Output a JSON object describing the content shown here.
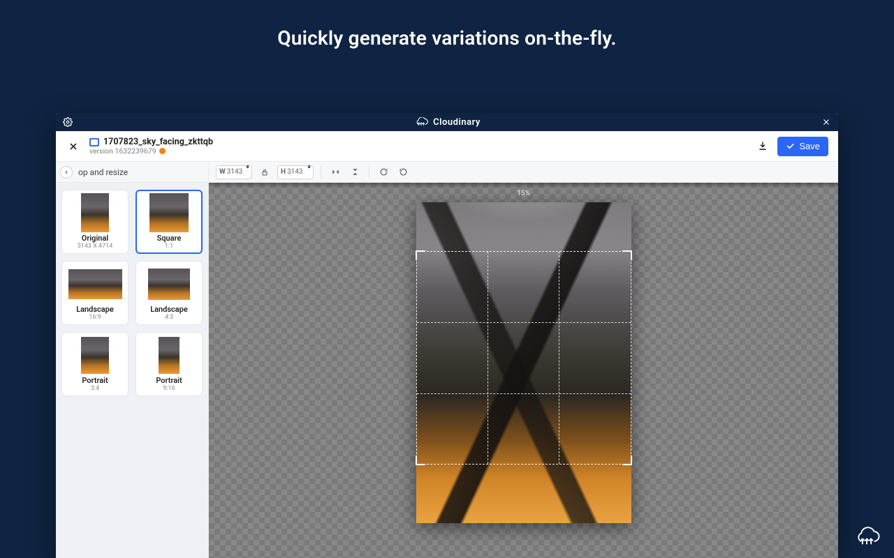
{
  "headline": "Quickly generate variations on-the-fly.",
  "brand": "Cloudinary",
  "file": {
    "name": "1707823_sky_facing_zkttqb",
    "version_label": "version 1632239679"
  },
  "actions": {
    "save": "Save"
  },
  "panel": {
    "title": "op and resize"
  },
  "dims": {
    "w_label": "W",
    "w_value": "3143",
    "h_label": "H",
    "h_value": "3143"
  },
  "zoom": "15%",
  "presets": [
    {
      "name": "Original",
      "sub": "3143 X 4714",
      "thumb": "thumb-orig",
      "selected": false
    },
    {
      "name": "Square",
      "sub": "1:1",
      "thumb": "thumb-sq",
      "selected": true
    },
    {
      "name": "Landscape",
      "sub": "16:9",
      "thumb": "thumb-169",
      "selected": false
    },
    {
      "name": "Landscape",
      "sub": "4:3",
      "thumb": "thumb-43",
      "selected": false
    },
    {
      "name": "Portrait",
      "sub": "3:4",
      "thumb": "thumb-34",
      "selected": false
    },
    {
      "name": "Portrait",
      "sub": "9:16",
      "thumb": "thumb-916",
      "selected": false
    }
  ]
}
